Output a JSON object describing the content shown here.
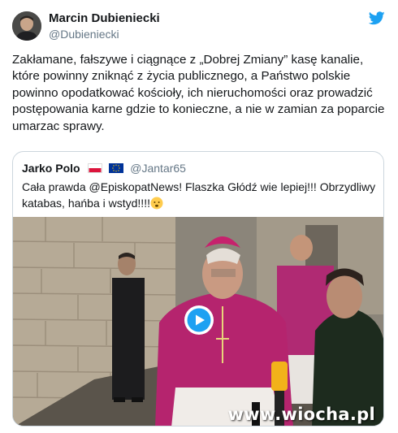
{
  "tweet": {
    "author_name": "Marcin Dubieniecki",
    "author_handle": "@Dubieniecki",
    "text": "Zakłamane, fałszywe i ciągnące z „Dobrej Zmiany” kasę kanalie, które powinny zniknąć z życia publicznego, a Państwo polskie powinno opodatkować kościoły, ich nieruchomości  oraz prowadzić postępowania karne gdzie to konieczne,  a nie w zamian za poparcie umarzac sprawy."
  },
  "quoted_tweet": {
    "author_name": "Jarko Polo",
    "author_handle": "@Jantar65",
    "text": "Cała prawda @EpiskopatNews! Flaszka Głódź wie lepiej!!! Obrzydliwy katabas, hańba i wstyd!!!!",
    "media": {
      "watermark": "www.wiocha.pl",
      "play_icon": "play-icon"
    }
  },
  "colors": {
    "twitter_blue": "#1da1f2",
    "text_primary": "#14171a",
    "text_secondary": "#657786",
    "border": "#ccd6dd"
  }
}
